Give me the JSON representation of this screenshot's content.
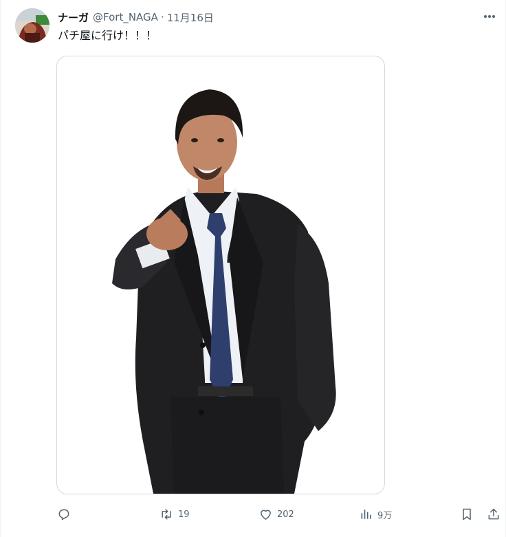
{
  "author": {
    "display_name": "ナーガ",
    "handle": "@Fort_NAGA",
    "separator": "·",
    "date": "11月16日"
  },
  "tweet": {
    "text": "パチ屋に行け！！！"
  },
  "media": {
    "description_icon": "photo-of-man-in-suit-pointing"
  },
  "actions": {
    "reply": {
      "icon": "reply-icon",
      "count": ""
    },
    "retweet": {
      "icon": "retweet-icon",
      "count": "19"
    },
    "like": {
      "icon": "heart-icon",
      "count": "202"
    },
    "views": {
      "icon": "views-chart-icon",
      "count": "9万"
    },
    "bookmark": {
      "icon": "bookmark-icon"
    },
    "share": {
      "icon": "share-icon"
    }
  },
  "colors": {
    "text_primary": "#0f1419",
    "text_secondary": "#536471",
    "border": "#cfd9de"
  }
}
